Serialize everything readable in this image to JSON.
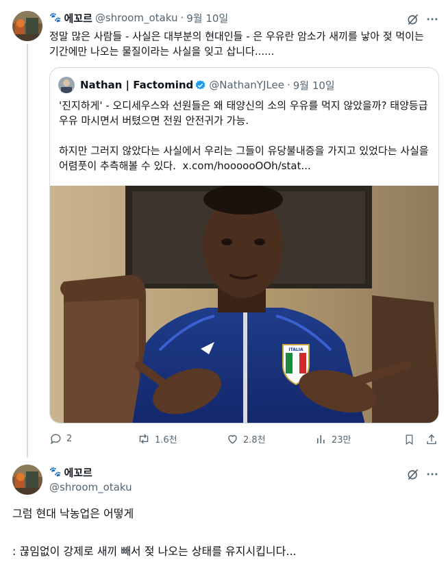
{
  "tweet": {
    "display_name": "에꼬르",
    "handle": "@shroom_otaku",
    "date": "9월 10일",
    "text": "정말 많은 사람들 - 사실은 대부분의 현대인들 - 은 우유란 암소가 새끼를 낳아 젖 먹이는 기간에만 나오는 물질이라는 사실을 잊고 삽니다......",
    "quote": {
      "display_name": "Nathan | Factomind",
      "handle": "@NathanYJLee",
      "date": "9월 10일",
      "para1": "'진지하게' - 오디세우스와 선원들은 왜 태양신의 소의 우유를 먹지 않았을까? 태양등급 우유 마시면서 버텼으면 전원 안전귀가 가능.",
      "para2": "하지만 그러지 않았다는 사실에서 우리는 그들이 유당불내증을 가지고 있었다는 사실을 어렴풋이 추측해볼 수 있다.  x.com/hoooooOOh/stat...",
      "image_jersey_text": "ITALIA"
    },
    "actions": {
      "replies": "2",
      "retweets": "1.6천",
      "likes": "2.8천",
      "views": "23만"
    }
  },
  "reply": {
    "display_name": "에꼬르",
    "handle": "@shroom_otaku",
    "line1": "그럼 현대 낙농업은 어떻게",
    "line2": ": 끊임없이 강제로 새끼 빼서 젖 나오는 상태를 유지시킵니다..."
  },
  "colors": {
    "text": "#0f1419",
    "secondary": "#536471",
    "border": "#cfd9de",
    "verified": "#1d9bf0"
  }
}
